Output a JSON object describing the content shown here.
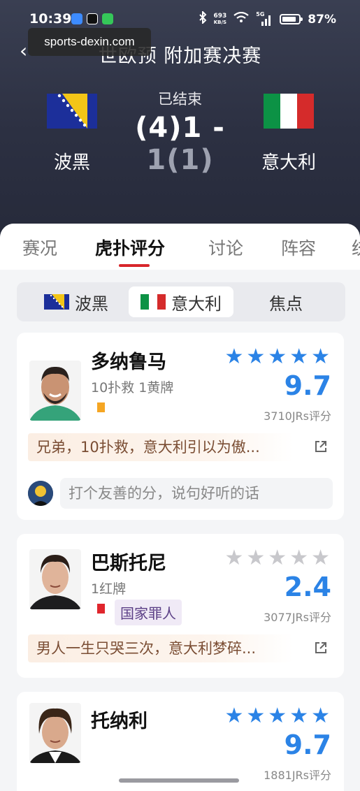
{
  "status_bar": {
    "time": "10:39",
    "net_speed": "693",
    "net_unit": "KB/S",
    "signal_label": "5G",
    "battery": "87%"
  },
  "watermark": "sports-dexin.com",
  "header": {
    "title": "世欧预 附加赛决赛",
    "state": "已结束",
    "score_home": "(4)1",
    "score_sep": " - ",
    "score_away": "1(1)",
    "home_team": "波黑",
    "away_team": "意大利"
  },
  "tabs": [
    "赛况",
    "虎扑评分",
    "讨论",
    "阵容",
    "统"
  ],
  "active_tab": "虎扑评分",
  "segments": [
    "波黑",
    "意大利",
    "焦点"
  ],
  "active_segment": "意大利",
  "players": [
    {
      "name": "多纳鲁马",
      "desc": "10扑救 1黄牌",
      "card": "yellow",
      "stars_on": 5,
      "rating": "9.7",
      "votes": "3710JRs评分",
      "comment": "兄弟，10扑救，意大利引以为傲...",
      "prompt": "打个友善的分，说句好听的话"
    },
    {
      "name": "巴斯托尼",
      "desc": "1红牌",
      "card": "red",
      "badge": "国家罪人",
      "stars_on": 0,
      "rating": "2.4",
      "votes": "3077JRs评分",
      "comment": "男人一生只哭三次，意大利梦碎..."
    },
    {
      "name": "托纳利",
      "stars_on": 5,
      "rating": "9.7",
      "votes": "1881JRs评分"
    }
  ],
  "colors": {
    "accent_blue": "#2b83e6",
    "tab_red": "#d8262b",
    "yellow_card": "#f5a623",
    "red_card": "#e0262d"
  }
}
